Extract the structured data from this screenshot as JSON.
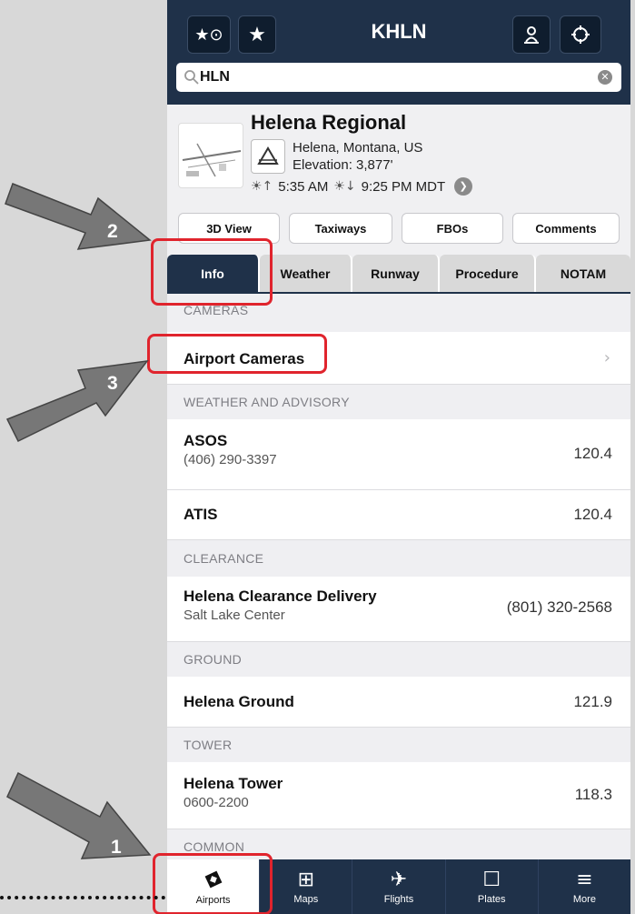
{
  "nav": {
    "favorites_recent_icon": "★⊙",
    "favorites_icon": "★",
    "title": "KHLN",
    "nearby_icon": "person-pin",
    "locate_icon": "⊕"
  },
  "search": {
    "value": "HLN",
    "clear_icon": "✕"
  },
  "airport": {
    "name": "Helena Regional",
    "city": "Helena, Montana, US",
    "elevation": "Elevation: 3,877'",
    "sunrise": "5:35 AM",
    "sunset": "9:25 PM MDT",
    "sun_arrow": "❯"
  },
  "actions": [
    "3D View",
    "Taxiways",
    "FBOs",
    "Comments"
  ],
  "tabs": [
    "Info",
    "Weather",
    "Runway",
    "Procedure",
    "NOTAM"
  ],
  "list": {
    "cameras_header": "CAMERAS",
    "airport_cameras": "Airport Cameras",
    "chevron": "›",
    "weather_header": "WEATHER AND ADVISORY",
    "asos_title": "ASOS",
    "asos_phone": "(406) 290-3397",
    "asos_freq": "120.4",
    "atis_title": "ATIS",
    "atis_freq": "120.4",
    "clearance_header": "CLEARANCE",
    "clearance_title": "Helena Clearance Delivery",
    "clearance_sub": "Salt Lake Center",
    "clearance_phone": "(801) 320-2568",
    "ground_header": "GROUND",
    "ground_title": "Helena Ground",
    "ground_freq": "121.9",
    "tower_header": "TOWER",
    "tower_title": "Helena Tower",
    "tower_hours": "0600-2200",
    "tower_freq": "118.3",
    "common_header": "COMMON"
  },
  "tabbar": [
    {
      "label": "Airports",
      "icon": "◆"
    },
    {
      "label": "Maps",
      "icon": "⊞"
    },
    {
      "label": "Flights",
      "icon": "✈"
    },
    {
      "label": "Plates",
      "icon": "☐"
    },
    {
      "label": "More",
      "icon": "≡"
    }
  ],
  "annotations": {
    "step1": "1",
    "step2": "2",
    "step3": "3",
    "highlight_color": "#e0242d"
  },
  "colors": {
    "navy": "#1f3149",
    "section_bg": "#efeff2"
  }
}
